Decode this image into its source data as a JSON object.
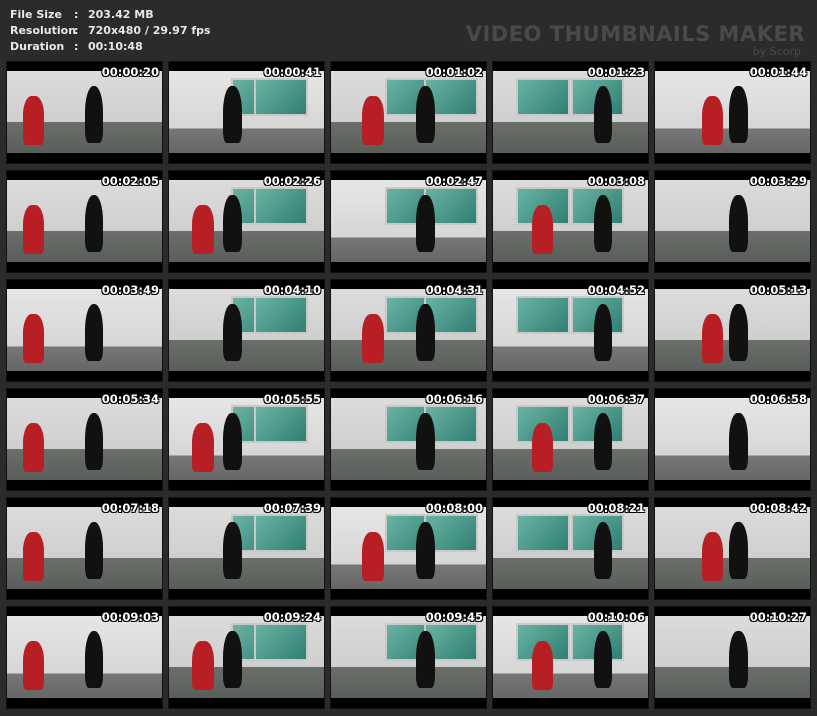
{
  "info": {
    "rows": [
      {
        "label": "File Size",
        "value": "203.42 MB"
      },
      {
        "label": "Resolution",
        "value": "720x480 / 29.97 fps"
      },
      {
        "label": "Duration",
        "value": "00:10:48"
      }
    ],
    "separator": ":"
  },
  "brand": {
    "title": "VIDEO THUMBNAILS MAKER",
    "subtitle": "by Scorp"
  },
  "thumbnails": [
    "00:00:20",
    "00:00:41",
    "00:01:02",
    "00:01:23",
    "00:01:44",
    "00:02:05",
    "00:02:26",
    "00:02:47",
    "00:03:08",
    "00:03:29",
    "00:03:49",
    "00:04:10",
    "00:04:31",
    "00:04:52",
    "00:05:13",
    "00:05:34",
    "00:05:55",
    "00:06:16",
    "00:06:37",
    "00:06:58",
    "00:07:18",
    "00:07:39",
    "00:08:00",
    "00:08:21",
    "00:08:42",
    "00:09:03",
    "00:09:24",
    "00:09:45",
    "00:10:06",
    "00:10:27"
  ]
}
